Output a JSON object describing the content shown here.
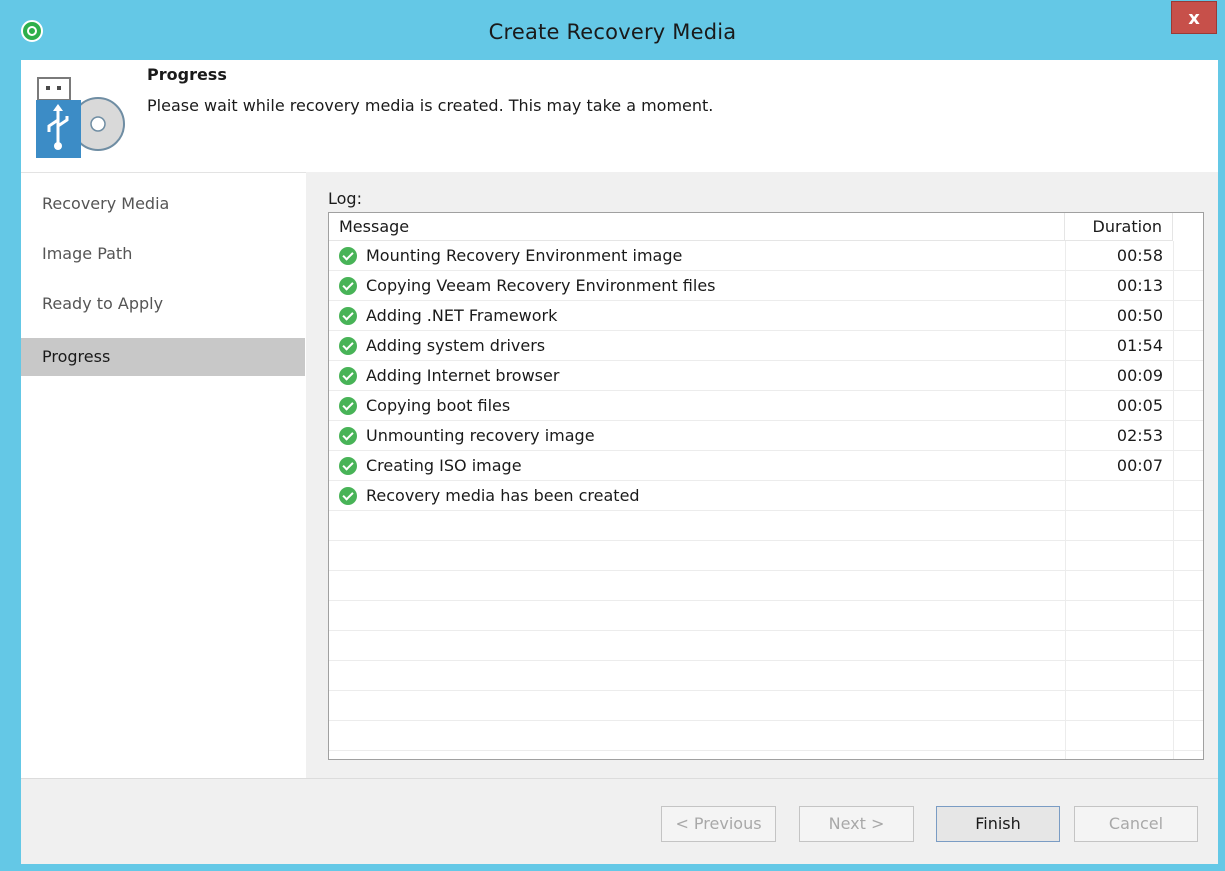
{
  "window": {
    "title": "Create Recovery Media",
    "close_label": "x"
  },
  "header": {
    "step_title": "Progress",
    "step_description": "Please wait while recovery media is created. This may take a moment."
  },
  "sidebar": {
    "items": [
      {
        "label": "Recovery Media",
        "active": false
      },
      {
        "label": "Image Path",
        "active": false
      },
      {
        "label": "Ready to Apply",
        "active": false
      },
      {
        "label": "Progress",
        "active": true
      }
    ]
  },
  "log": {
    "label": "Log:",
    "columns": {
      "message": "Message",
      "duration": "Duration"
    },
    "rows": [
      {
        "status": "success",
        "message": "Mounting Recovery Environment image",
        "duration": "00:58"
      },
      {
        "status": "success",
        "message": "Copying Veeam Recovery Environment files",
        "duration": "00:13"
      },
      {
        "status": "success",
        "message": "Adding .NET Framework",
        "duration": "00:50"
      },
      {
        "status": "success",
        "message": "Adding system drivers",
        "duration": "01:54"
      },
      {
        "status": "success",
        "message": "Adding Internet browser",
        "duration": "00:09"
      },
      {
        "status": "success",
        "message": "Copying boot files",
        "duration": "00:05"
      },
      {
        "status": "success",
        "message": "Unmounting recovery image",
        "duration": "02:53"
      },
      {
        "status": "success",
        "message": "Creating ISO image",
        "duration": "00:07"
      },
      {
        "status": "success",
        "message": "Recovery media has been created",
        "duration": ""
      }
    ]
  },
  "footer": {
    "previous_label": "< Previous",
    "next_label": "Next >",
    "finish_label": "Finish",
    "cancel_label": "Cancel"
  },
  "colors": {
    "titlebar": "#64c8e6",
    "success": "#48b357",
    "close_button": "#c7504a",
    "active_nav": "#c8c8c8"
  }
}
